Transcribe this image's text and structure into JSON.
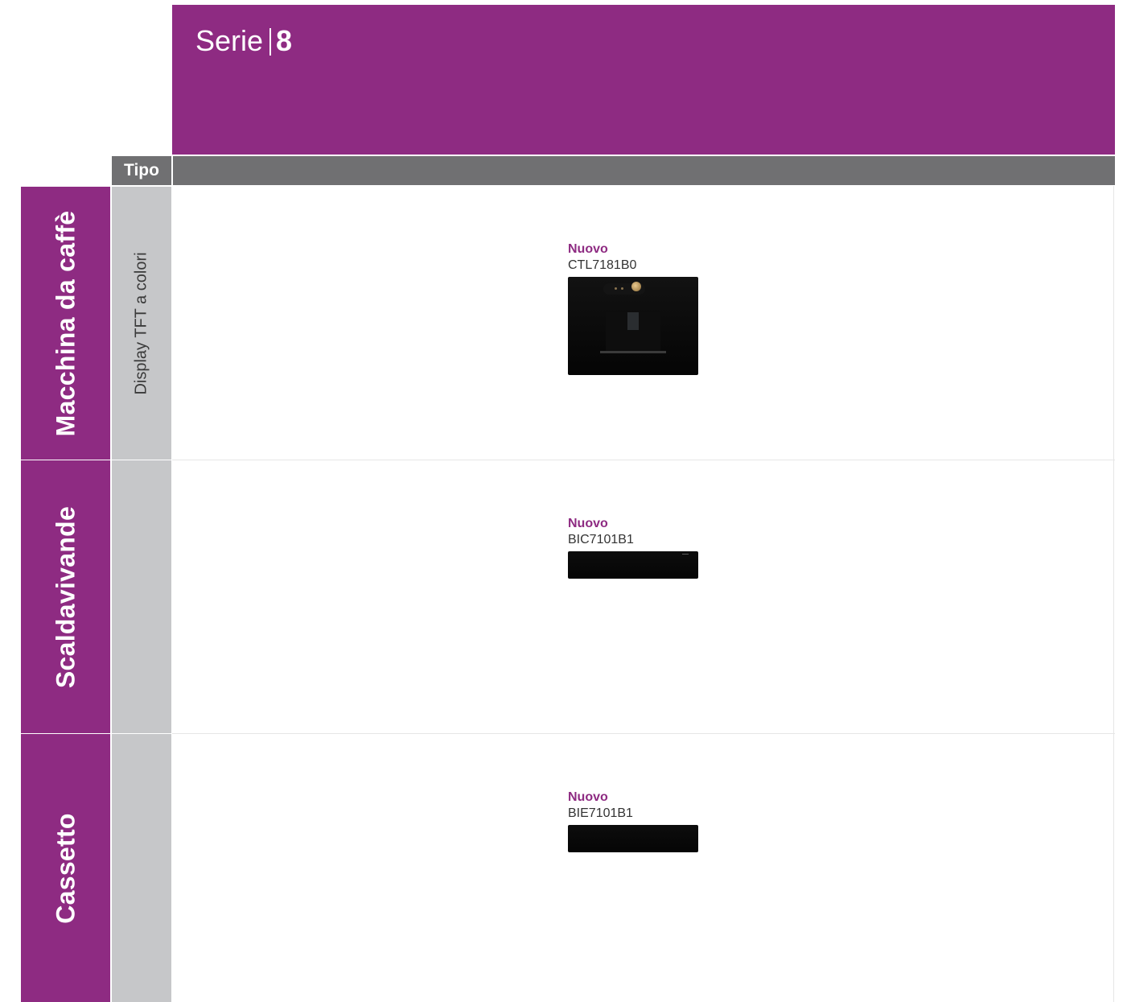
{
  "header": {
    "series_word": "Serie",
    "series_number": "8"
  },
  "tipo_header": "Tipo",
  "rows": [
    {
      "category": "Macchina da caffè",
      "tipo": "Display TFT a colori",
      "product": {
        "badge": "Nuovo",
        "code": "CTL7181B0",
        "image": "built-in coffee machine, black"
      }
    },
    {
      "category": "Scaldavivande",
      "tipo": "",
      "product": {
        "badge": "Nuovo",
        "code": "BIC7101B1",
        "image": "warming drawer, black"
      }
    },
    {
      "category": "Cassetto",
      "tipo": "",
      "product": {
        "badge": "Nuovo",
        "code": "BIE7101B1",
        "image": "accessory drawer, black"
      }
    }
  ],
  "colors": {
    "brand_purple": "#8e2b82",
    "header_gray": "#707072",
    "tipo_cell_gray": "#c6c7c9"
  }
}
